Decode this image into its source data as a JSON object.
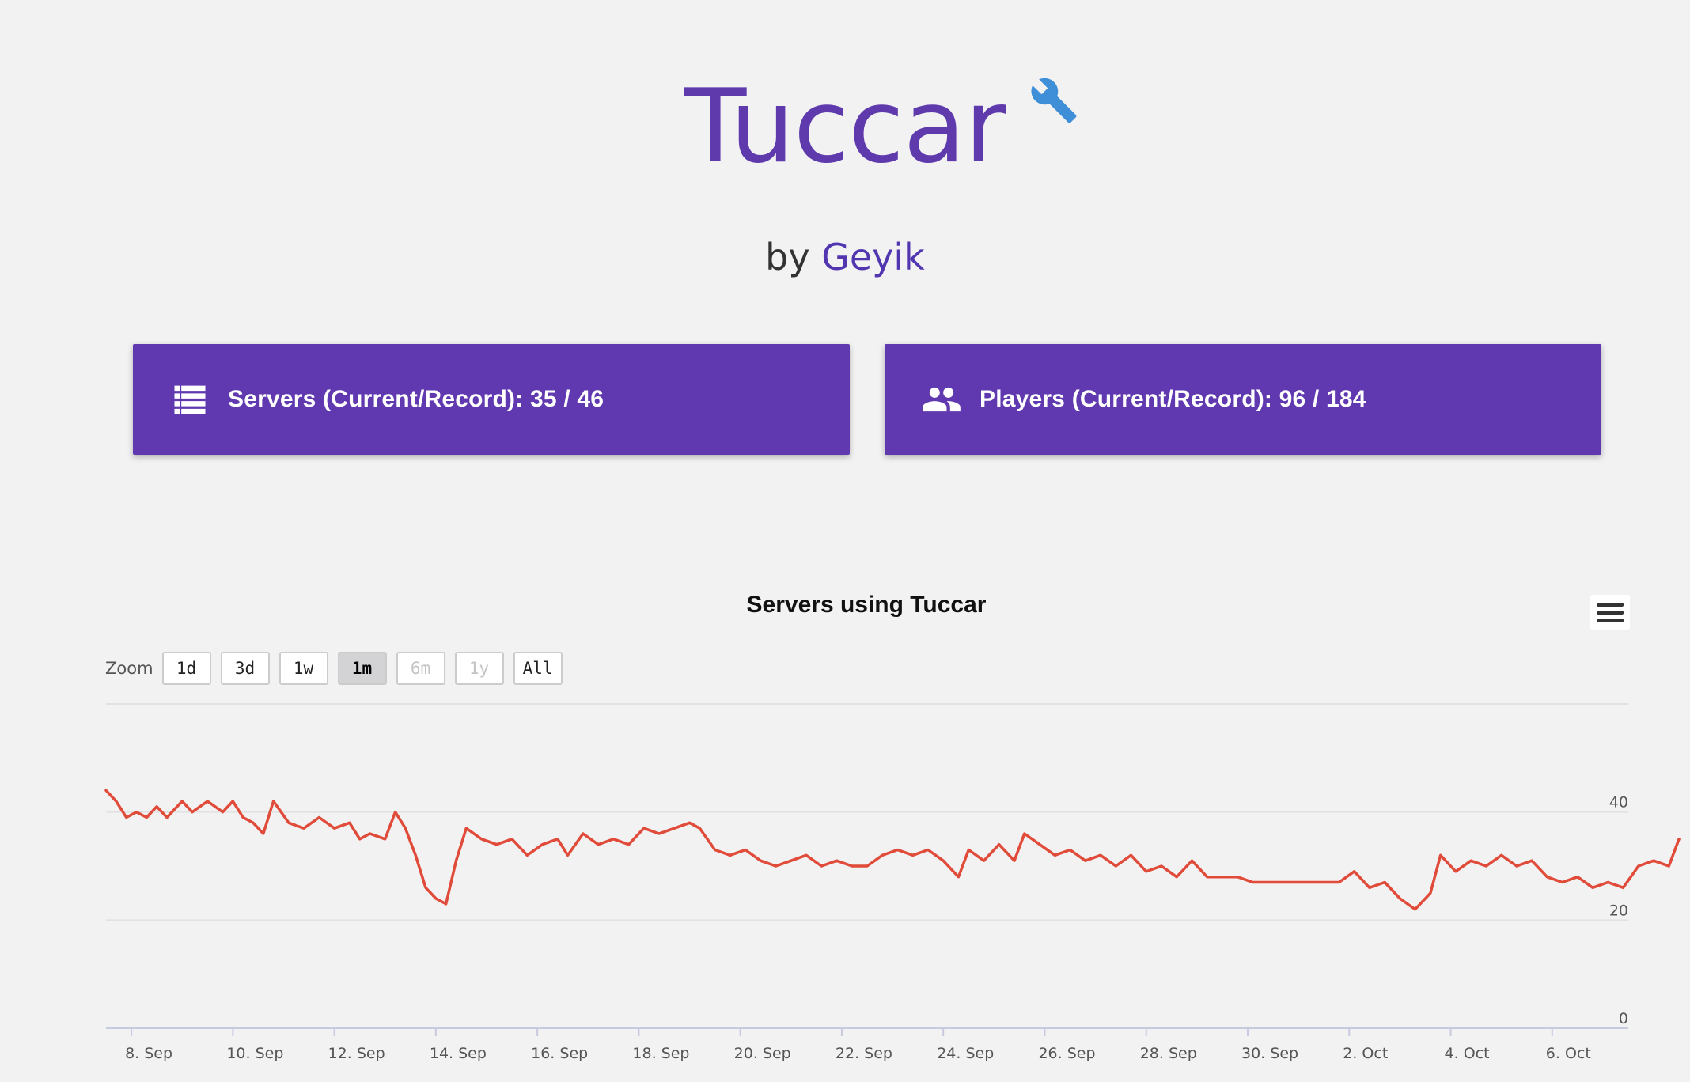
{
  "header": {
    "title": "Tuccar",
    "by_prefix": "by ",
    "author": "Geyik",
    "wrench_icon": "wrench-icon"
  },
  "stats": {
    "servers": {
      "label": "Servers (Current/Record): 35 / 46",
      "icon": "server-list-icon",
      "current": 35,
      "record": 46
    },
    "players": {
      "label": "Players (Current/Record): 96 / 184",
      "icon": "people-icon",
      "current": 96,
      "record": 184
    }
  },
  "colors": {
    "accent": "#6039b0",
    "title": "#5f3aad",
    "link": "#5136b0",
    "series": "#e04b3a",
    "wrench": "#3f8fd8"
  },
  "zoom": {
    "label": "Zoom",
    "buttons": [
      {
        "label": "1d",
        "state": "normal"
      },
      {
        "label": "3d",
        "state": "normal"
      },
      {
        "label": "1w",
        "state": "normal"
      },
      {
        "label": "1m",
        "state": "active"
      },
      {
        "label": "6m",
        "state": "disabled"
      },
      {
        "label": "1y",
        "state": "disabled"
      },
      {
        "label": "All",
        "state": "normal"
      }
    ]
  },
  "chart_data": {
    "type": "line",
    "title": "Servers using Tuccar",
    "xlabel": "",
    "ylabel": "",
    "ylim": [
      0,
      60
    ],
    "yticks": [
      0,
      20,
      40
    ],
    "y_axis_side": "right",
    "grid": true,
    "legend": "none",
    "x_start": "7. Sep 12:00",
    "x_end": "7. Oct 12:00",
    "xticks": [
      "8. Sep",
      "10. Sep",
      "12. Sep",
      "14. Sep",
      "16. Sep",
      "18. Sep",
      "20. Sep",
      "22. Sep",
      "24. Sep",
      "26. Sep",
      "28. Sep",
      "30. Sep",
      "2. Oct",
      "4. Oct",
      "6. Oct"
    ],
    "series": [
      {
        "values": [
          [
            0.0,
            44
          ],
          [
            0.2,
            42
          ],
          [
            0.4,
            39
          ],
          [
            0.6,
            40
          ],
          [
            0.8,
            39
          ],
          [
            1.0,
            41
          ],
          [
            1.2,
            39
          ],
          [
            1.5,
            42
          ],
          [
            1.7,
            40
          ],
          [
            2.0,
            42
          ],
          [
            2.3,
            40
          ],
          [
            2.5,
            42
          ],
          [
            2.7,
            39
          ],
          [
            2.9,
            38
          ],
          [
            3.1,
            36
          ],
          [
            3.3,
            42
          ],
          [
            3.6,
            38
          ],
          [
            3.9,
            37
          ],
          [
            4.2,
            39
          ],
          [
            4.5,
            37
          ],
          [
            4.8,
            38
          ],
          [
            5.0,
            35
          ],
          [
            5.2,
            36
          ],
          [
            5.5,
            35
          ],
          [
            5.7,
            40
          ],
          [
            5.9,
            37
          ],
          [
            6.1,
            32
          ],
          [
            6.3,
            26
          ],
          [
            6.5,
            24
          ],
          [
            6.7,
            23
          ],
          [
            6.9,
            31
          ],
          [
            7.1,
            37
          ],
          [
            7.4,
            35
          ],
          [
            7.7,
            34
          ],
          [
            8.0,
            35
          ],
          [
            8.3,
            32
          ],
          [
            8.6,
            34
          ],
          [
            8.9,
            35
          ],
          [
            9.1,
            32
          ],
          [
            9.4,
            36
          ],
          [
            9.7,
            34
          ],
          [
            10.0,
            35
          ],
          [
            10.3,
            34
          ],
          [
            10.6,
            37
          ],
          [
            10.9,
            36
          ],
          [
            11.2,
            37
          ],
          [
            11.5,
            38
          ],
          [
            11.7,
            37
          ],
          [
            12.0,
            33
          ],
          [
            12.3,
            32
          ],
          [
            12.6,
            33
          ],
          [
            12.9,
            31
          ],
          [
            13.2,
            30
          ],
          [
            13.5,
            31
          ],
          [
            13.8,
            32
          ],
          [
            14.1,
            30
          ],
          [
            14.4,
            31
          ],
          [
            14.7,
            30
          ],
          [
            15.0,
            30
          ],
          [
            15.3,
            32
          ],
          [
            15.6,
            33
          ],
          [
            15.9,
            32
          ],
          [
            16.2,
            33
          ],
          [
            16.5,
            31
          ],
          [
            16.8,
            28
          ],
          [
            17.0,
            33
          ],
          [
            17.3,
            31
          ],
          [
            17.6,
            34
          ],
          [
            17.9,
            31
          ],
          [
            18.1,
            36
          ],
          [
            18.4,
            34
          ],
          [
            18.7,
            32
          ],
          [
            19.0,
            33
          ],
          [
            19.3,
            31
          ],
          [
            19.6,
            32
          ],
          [
            19.9,
            30
          ],
          [
            20.2,
            32
          ],
          [
            20.5,
            29
          ],
          [
            20.8,
            30
          ],
          [
            21.1,
            28
          ],
          [
            21.4,
            31
          ],
          [
            21.7,
            28
          ],
          [
            22.0,
            28
          ],
          [
            22.3,
            28
          ],
          [
            22.6,
            27
          ],
          [
            22.9,
            27
          ],
          [
            23.2,
            27
          ],
          [
            23.5,
            27
          ],
          [
            24.0,
            27
          ],
          [
            24.3,
            27
          ],
          [
            24.6,
            29
          ],
          [
            24.9,
            26
          ],
          [
            25.2,
            27
          ],
          [
            25.5,
            24
          ],
          [
            25.8,
            22
          ],
          [
            26.1,
            25
          ],
          [
            26.3,
            32
          ],
          [
            26.6,
            29
          ],
          [
            26.9,
            31
          ],
          [
            27.2,
            30
          ],
          [
            27.5,
            32
          ],
          [
            27.8,
            30
          ],
          [
            28.1,
            31
          ],
          [
            28.4,
            28
          ],
          [
            28.7,
            27
          ],
          [
            29.0,
            28
          ],
          [
            29.3,
            26
          ],
          [
            29.6,
            27
          ],
          [
            29.9,
            26
          ],
          [
            30.2,
            30
          ],
          [
            30.5,
            31
          ],
          [
            30.8,
            30
          ],
          [
            31.0,
            35
          ]
        ]
      }
    ]
  }
}
